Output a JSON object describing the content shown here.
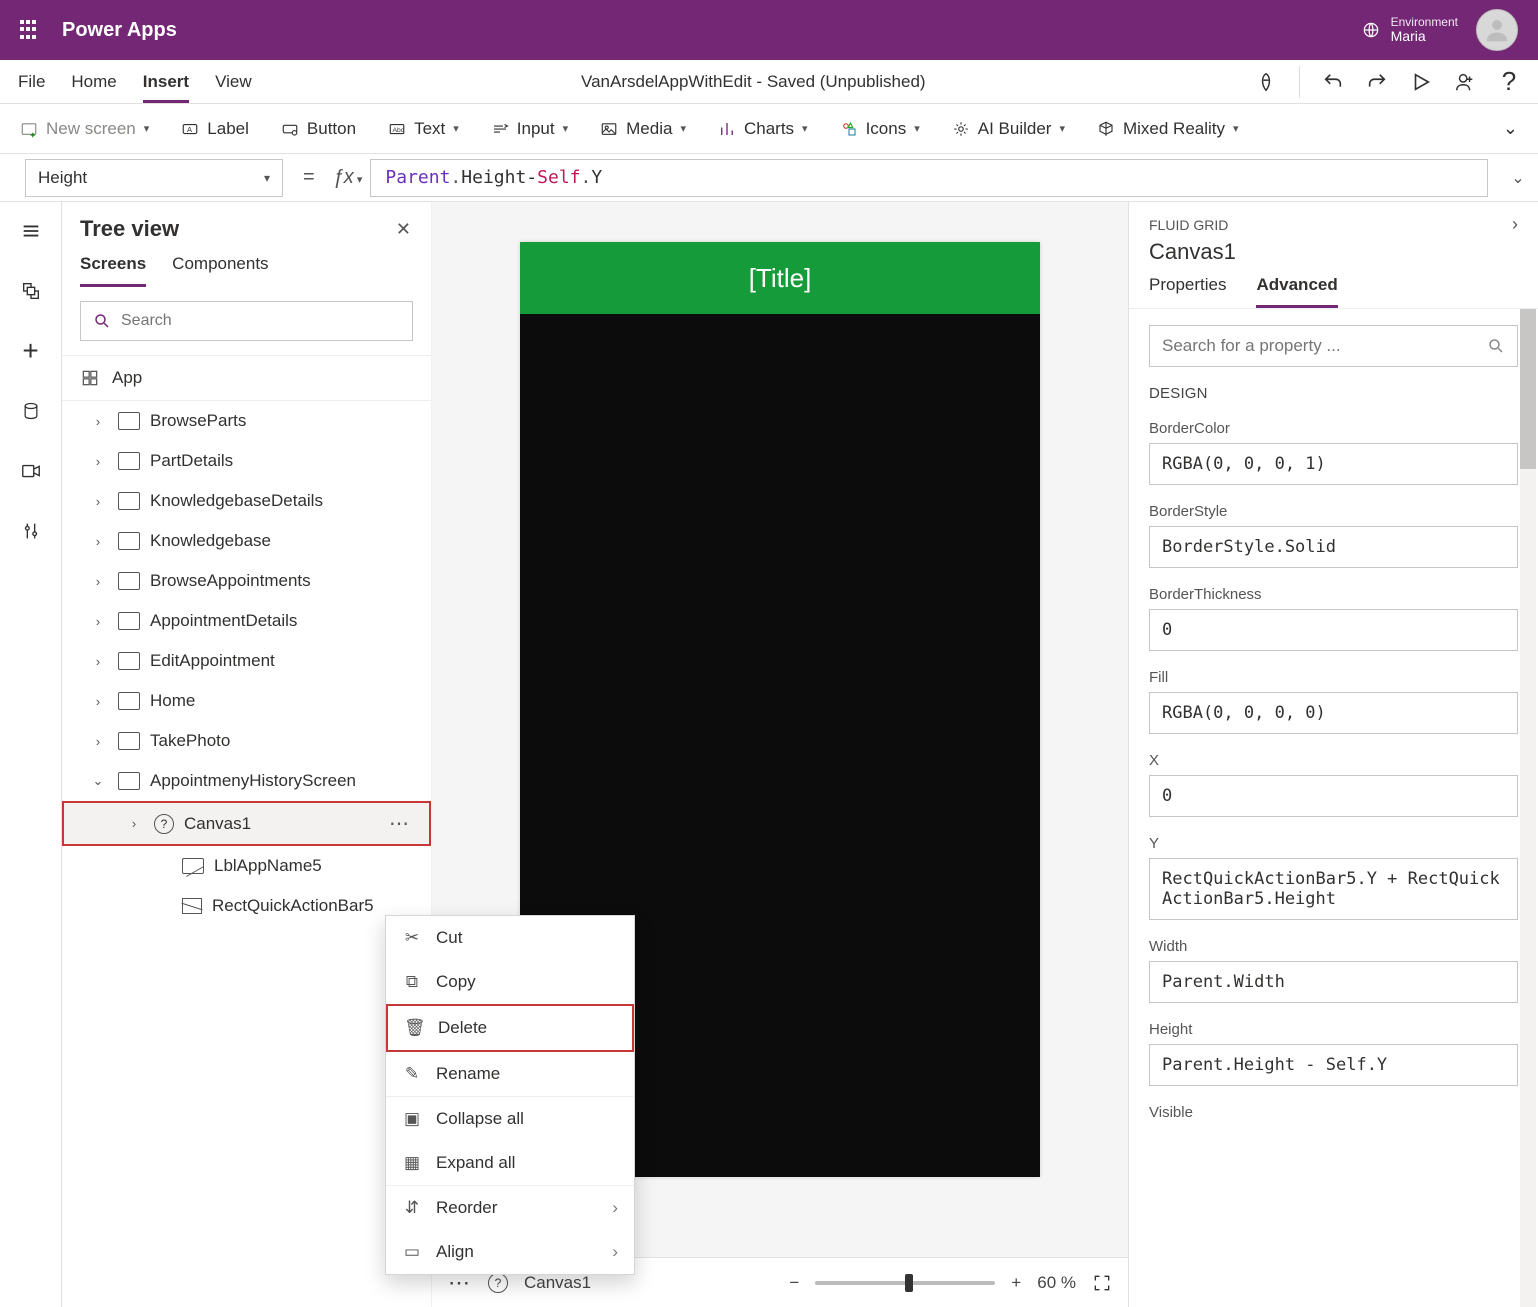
{
  "top": {
    "app_name": "Power Apps",
    "env_label": "Environment",
    "env_value": "Maria"
  },
  "menubar": {
    "items": [
      "File",
      "Home",
      "Insert",
      "View"
    ],
    "active_index": 2,
    "doc_status": "VanArsdelAppWithEdit - Saved (Unpublished)"
  },
  "ribbon": {
    "items": [
      {
        "label": "New screen",
        "chev": true,
        "disabled": true
      },
      {
        "label": "Label"
      },
      {
        "label": "Button"
      },
      {
        "label": "Text",
        "chev": true
      },
      {
        "label": "Input",
        "chev": true
      },
      {
        "label": "Media",
        "chev": true
      },
      {
        "label": "Charts",
        "chev": true
      },
      {
        "label": "Icons",
        "chev": true
      },
      {
        "label": "AI Builder",
        "chev": true
      },
      {
        "label": "Mixed Reality",
        "chev": true
      }
    ]
  },
  "formula": {
    "property": "Height",
    "raw_parts": [
      "Parent",
      ".",
      "Height",
      " - ",
      "Self",
      ".",
      "Y"
    ]
  },
  "tree": {
    "title": "Tree view",
    "tabs": {
      "items": [
        "Screens",
        "Components"
      ],
      "active_index": 0
    },
    "search_placeholder": "Search",
    "app_label": "App",
    "items": [
      {
        "label": "BrowseParts",
        "type": "screen"
      },
      {
        "label": "PartDetails",
        "type": "screen"
      },
      {
        "label": "KnowledgebaseDetails",
        "type": "screen"
      },
      {
        "label": "Knowledgebase",
        "type": "screen"
      },
      {
        "label": "BrowseAppointments",
        "type": "screen"
      },
      {
        "label": "AppointmentDetails",
        "type": "screen"
      },
      {
        "label": "EditAppointment",
        "type": "screen"
      },
      {
        "label": "Home",
        "type": "screen"
      },
      {
        "label": "TakePhoto",
        "type": "screen"
      },
      {
        "label": "AppointmenyHistoryScreen",
        "type": "screen",
        "expanded": true,
        "children": [
          {
            "label": "Canvas1",
            "type": "canvas",
            "selected": true,
            "expandable": true,
            "hasmore": true
          },
          {
            "label": "LblAppName5",
            "type": "label"
          },
          {
            "label": "RectQuickActionBar5",
            "type": "rect"
          }
        ]
      }
    ]
  },
  "canvas": {
    "title_text": "[Title]",
    "status_name": "Canvas1",
    "zoom_pct": "60"
  },
  "context_menu": [
    {
      "label": "Cut",
      "icon": "cut"
    },
    {
      "label": "Copy",
      "icon": "copy"
    },
    {
      "label": "Delete",
      "icon": "delete",
      "highlight": true
    },
    {
      "label": "Rename",
      "icon": "rename"
    },
    {
      "label": "Collapse all",
      "icon": "collapse"
    },
    {
      "label": "Expand all",
      "icon": "expand"
    },
    {
      "label": "Reorder",
      "icon": "reorder",
      "sub": true
    },
    {
      "label": "Align",
      "icon": "align",
      "sub": true
    }
  ],
  "props": {
    "header_small": "FLUID GRID",
    "obj_name": "Canvas1",
    "tabs": {
      "items": [
        "Properties",
        "Advanced"
      ],
      "active_index": 1
    },
    "search_placeholder": "Search for a property ...",
    "section": "DESIGN",
    "fields": [
      {
        "name": "BorderColor",
        "value": "RGBA(0, 0, 0, 1)"
      },
      {
        "name": "BorderStyle",
        "value": "BorderStyle.Solid"
      },
      {
        "name": "BorderThickness",
        "value": "0"
      },
      {
        "name": "Fill",
        "value": "RGBA(0, 0, 0, 0)"
      },
      {
        "name": "X",
        "value": "0"
      },
      {
        "name": "Y",
        "value": "RectQuickActionBar5.Y + RectQuickActionBar5.Height"
      },
      {
        "name": "Width",
        "value": "Parent.Width"
      },
      {
        "name": "Height",
        "value": "Parent.Height - Self.Y"
      },
      {
        "name": "Visible",
        "value": ""
      }
    ]
  }
}
